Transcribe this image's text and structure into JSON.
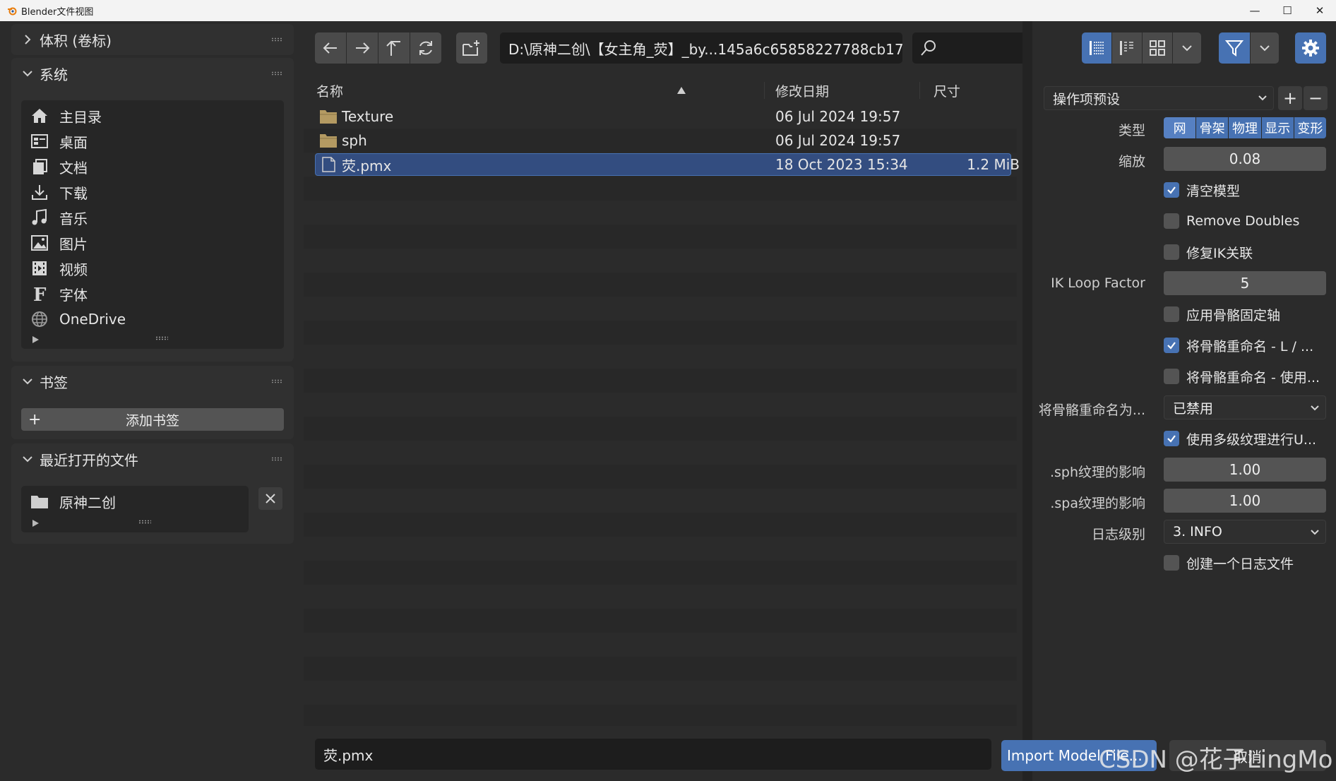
{
  "window": {
    "title": "Blender文件视图"
  },
  "sidebar": {
    "volumes": {
      "label": "体积 (卷标)"
    },
    "system": {
      "label": "系统",
      "items": [
        {
          "label": "主目录",
          "icon": "home-icon"
        },
        {
          "label": "桌面",
          "icon": "desktop-icon"
        },
        {
          "label": "文档",
          "icon": "documents-icon"
        },
        {
          "label": "下载",
          "icon": "download-icon"
        },
        {
          "label": "音乐",
          "icon": "music-icon"
        },
        {
          "label": "图片",
          "icon": "image-icon"
        },
        {
          "label": "视频",
          "icon": "video-icon"
        },
        {
          "label": "字体",
          "icon": "font-icon"
        },
        {
          "label": "OneDrive",
          "icon": "globe-icon"
        }
      ]
    },
    "bookmarks": {
      "label": "书签",
      "add_label": "添加书签"
    },
    "recent": {
      "label": "最近打开的文件",
      "items": [
        {
          "label": "原神二创"
        }
      ]
    }
  },
  "toolbar": {
    "path": "D:\\原神二创\\【女主角_荧】_by...145a6c65858227788cb173\\",
    "search_placeholder": ""
  },
  "filelist": {
    "columns": {
      "name": "名称",
      "date": "修改日期",
      "size": "尺寸"
    },
    "rows": [
      {
        "name": "Texture",
        "date": "06 Jul 2024 19:57",
        "size": "",
        "kind": "folder"
      },
      {
        "name": "sph",
        "date": "06 Jul 2024 19:57",
        "size": "",
        "kind": "folder"
      },
      {
        "name": "荧.pmx",
        "date": "18 Oct 2023 15:34",
        "size": "1.2 MiB",
        "kind": "file",
        "selected": true
      }
    ]
  },
  "bottom": {
    "filename": "荧.pmx",
    "import_label": "Import Model File...",
    "cancel_label": "取消"
  },
  "props": {
    "preset": "操作项预设",
    "type_label": "类型",
    "type_options": [
      "网",
      "骨架",
      "物理",
      "显示",
      "变形"
    ],
    "scale_label": "缩放",
    "scale_value": "0.08",
    "clean_model": "清空模型",
    "remove_doubles": "Remove Doubles",
    "fix_ik": "修复IK关联",
    "ik_loop_label": "IK Loop Factor",
    "ik_loop_value": "5",
    "apply_bone_axis": "应用骨骼固定轴",
    "rename_bones_lr": "将骨骼重命名 - L / ...",
    "rename_bones_use": "将骨骼重命名 - 使用...",
    "rename_as_label": "将骨骼重命名为...",
    "rename_as_value": "已禁用",
    "use_mipmap": "使用多级纹理进行U...",
    "sph_label": ".sph纹理的影响",
    "sph_value": "1.00",
    "spa_label": ".spa纹理的影响",
    "spa_value": "1.00",
    "log_label": "日志级别",
    "log_value": "3. INFO",
    "create_log": "创建一个日志文件"
  },
  "watermark": "CSDN @花子LingMo",
  "colors": {
    "accent": "#4772b3",
    "selected_row": "#334d80",
    "panel_bg": "#2b2b2b"
  }
}
